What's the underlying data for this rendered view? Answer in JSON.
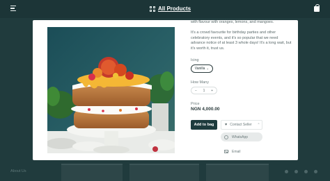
{
  "header": {
    "menu_icon": "hamburger-icon",
    "nav_icon": "grid-icon",
    "nav_label": "All Products",
    "bag_icon": "shopping-bag-icon"
  },
  "product": {
    "description_line1": "with flavour with oranges, lemons, and mangoes.",
    "description_para2": "It's a crowd favourite for birthday parties and other celebratory events, and it's so popular that we need advance notice of at least 3 whole days! It's a long wait, but it's worth it, trust us.",
    "icing_label": "Icing",
    "icing_value": "Vanilla",
    "quantity_label": "How Many",
    "quantity_minus": "−",
    "quantity_value": "1",
    "quantity_plus": "+",
    "price_label": "Price",
    "price_value": "NGN 4,000.00",
    "add_to_bag_label": "Add to bag",
    "contact_seller_label": "Contact Seller",
    "contact_options": [
      {
        "label": "WhatsApp",
        "icon": "whatsapp-icon"
      },
      {
        "label": "Email",
        "icon": "email-icon"
      }
    ]
  },
  "background": {
    "footer_text": "About Us"
  },
  "colors": {
    "brand_dark": "#1d3b3d",
    "page_bg": "#1f3a3c"
  }
}
